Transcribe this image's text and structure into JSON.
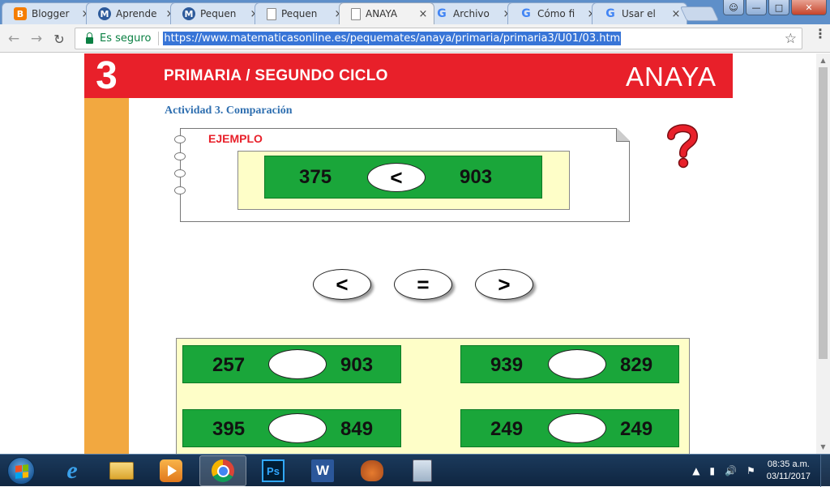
{
  "tabs": [
    {
      "title": "Blogger",
      "favicon": "blogger-icon"
    },
    {
      "title": "Aprende",
      "favicon": "m-icon"
    },
    {
      "title": "Pequen",
      "favicon": "m-icon"
    },
    {
      "title": "Pequen",
      "favicon": "doc-icon"
    },
    {
      "title": "ANAYA",
      "favicon": "doc-icon",
      "active": true
    },
    {
      "title": "Archivo",
      "favicon": "google-icon"
    },
    {
      "title": "Cómo fi",
      "favicon": "google-icon"
    },
    {
      "title": "Usar el",
      "favicon": "google-icon"
    }
  ],
  "tab_close": "×",
  "omnibox": {
    "secure_label": "Es seguro",
    "url": "https://www.matematicasonline.es/pequemates/anaya/primaria/primaria3/U01/03.htm"
  },
  "banner": {
    "number": "3",
    "title": "PRIMARIA / SEGUNDO CICLO",
    "logo": "ANAYA",
    "color": "#e8202a"
  },
  "activity_title": "Actividad 3. Comparación",
  "example": {
    "label": "EJEMPLO",
    "left": "375",
    "symbol": "<",
    "right": "903"
  },
  "choices": [
    "<",
    "=",
    ">"
  ],
  "exercises": [
    {
      "left": "257",
      "answer": "",
      "right": "903"
    },
    {
      "left": "939",
      "answer": "",
      "right": "829"
    },
    {
      "left": "395",
      "answer": "",
      "right": "849"
    },
    {
      "left": "249",
      "answer": "",
      "right": "249"
    }
  ],
  "taskbar": {
    "apps": [
      "ie-icon",
      "folder-icon",
      "media-player-icon",
      "chrome-icon",
      "photoshop-icon",
      "word-icon",
      "glove-icon",
      "calculator-icon"
    ],
    "ps_label": "Ps",
    "word_label": "W",
    "ie_label": "e",
    "time": "08:35 a.m.",
    "date": "03/11/2017"
  },
  "colors": {
    "accent_green": "#1aa63a",
    "sidebar_orange": "#f2a840",
    "panel_yellow": "#fefec8",
    "title_blue": "#2f6fb0"
  }
}
